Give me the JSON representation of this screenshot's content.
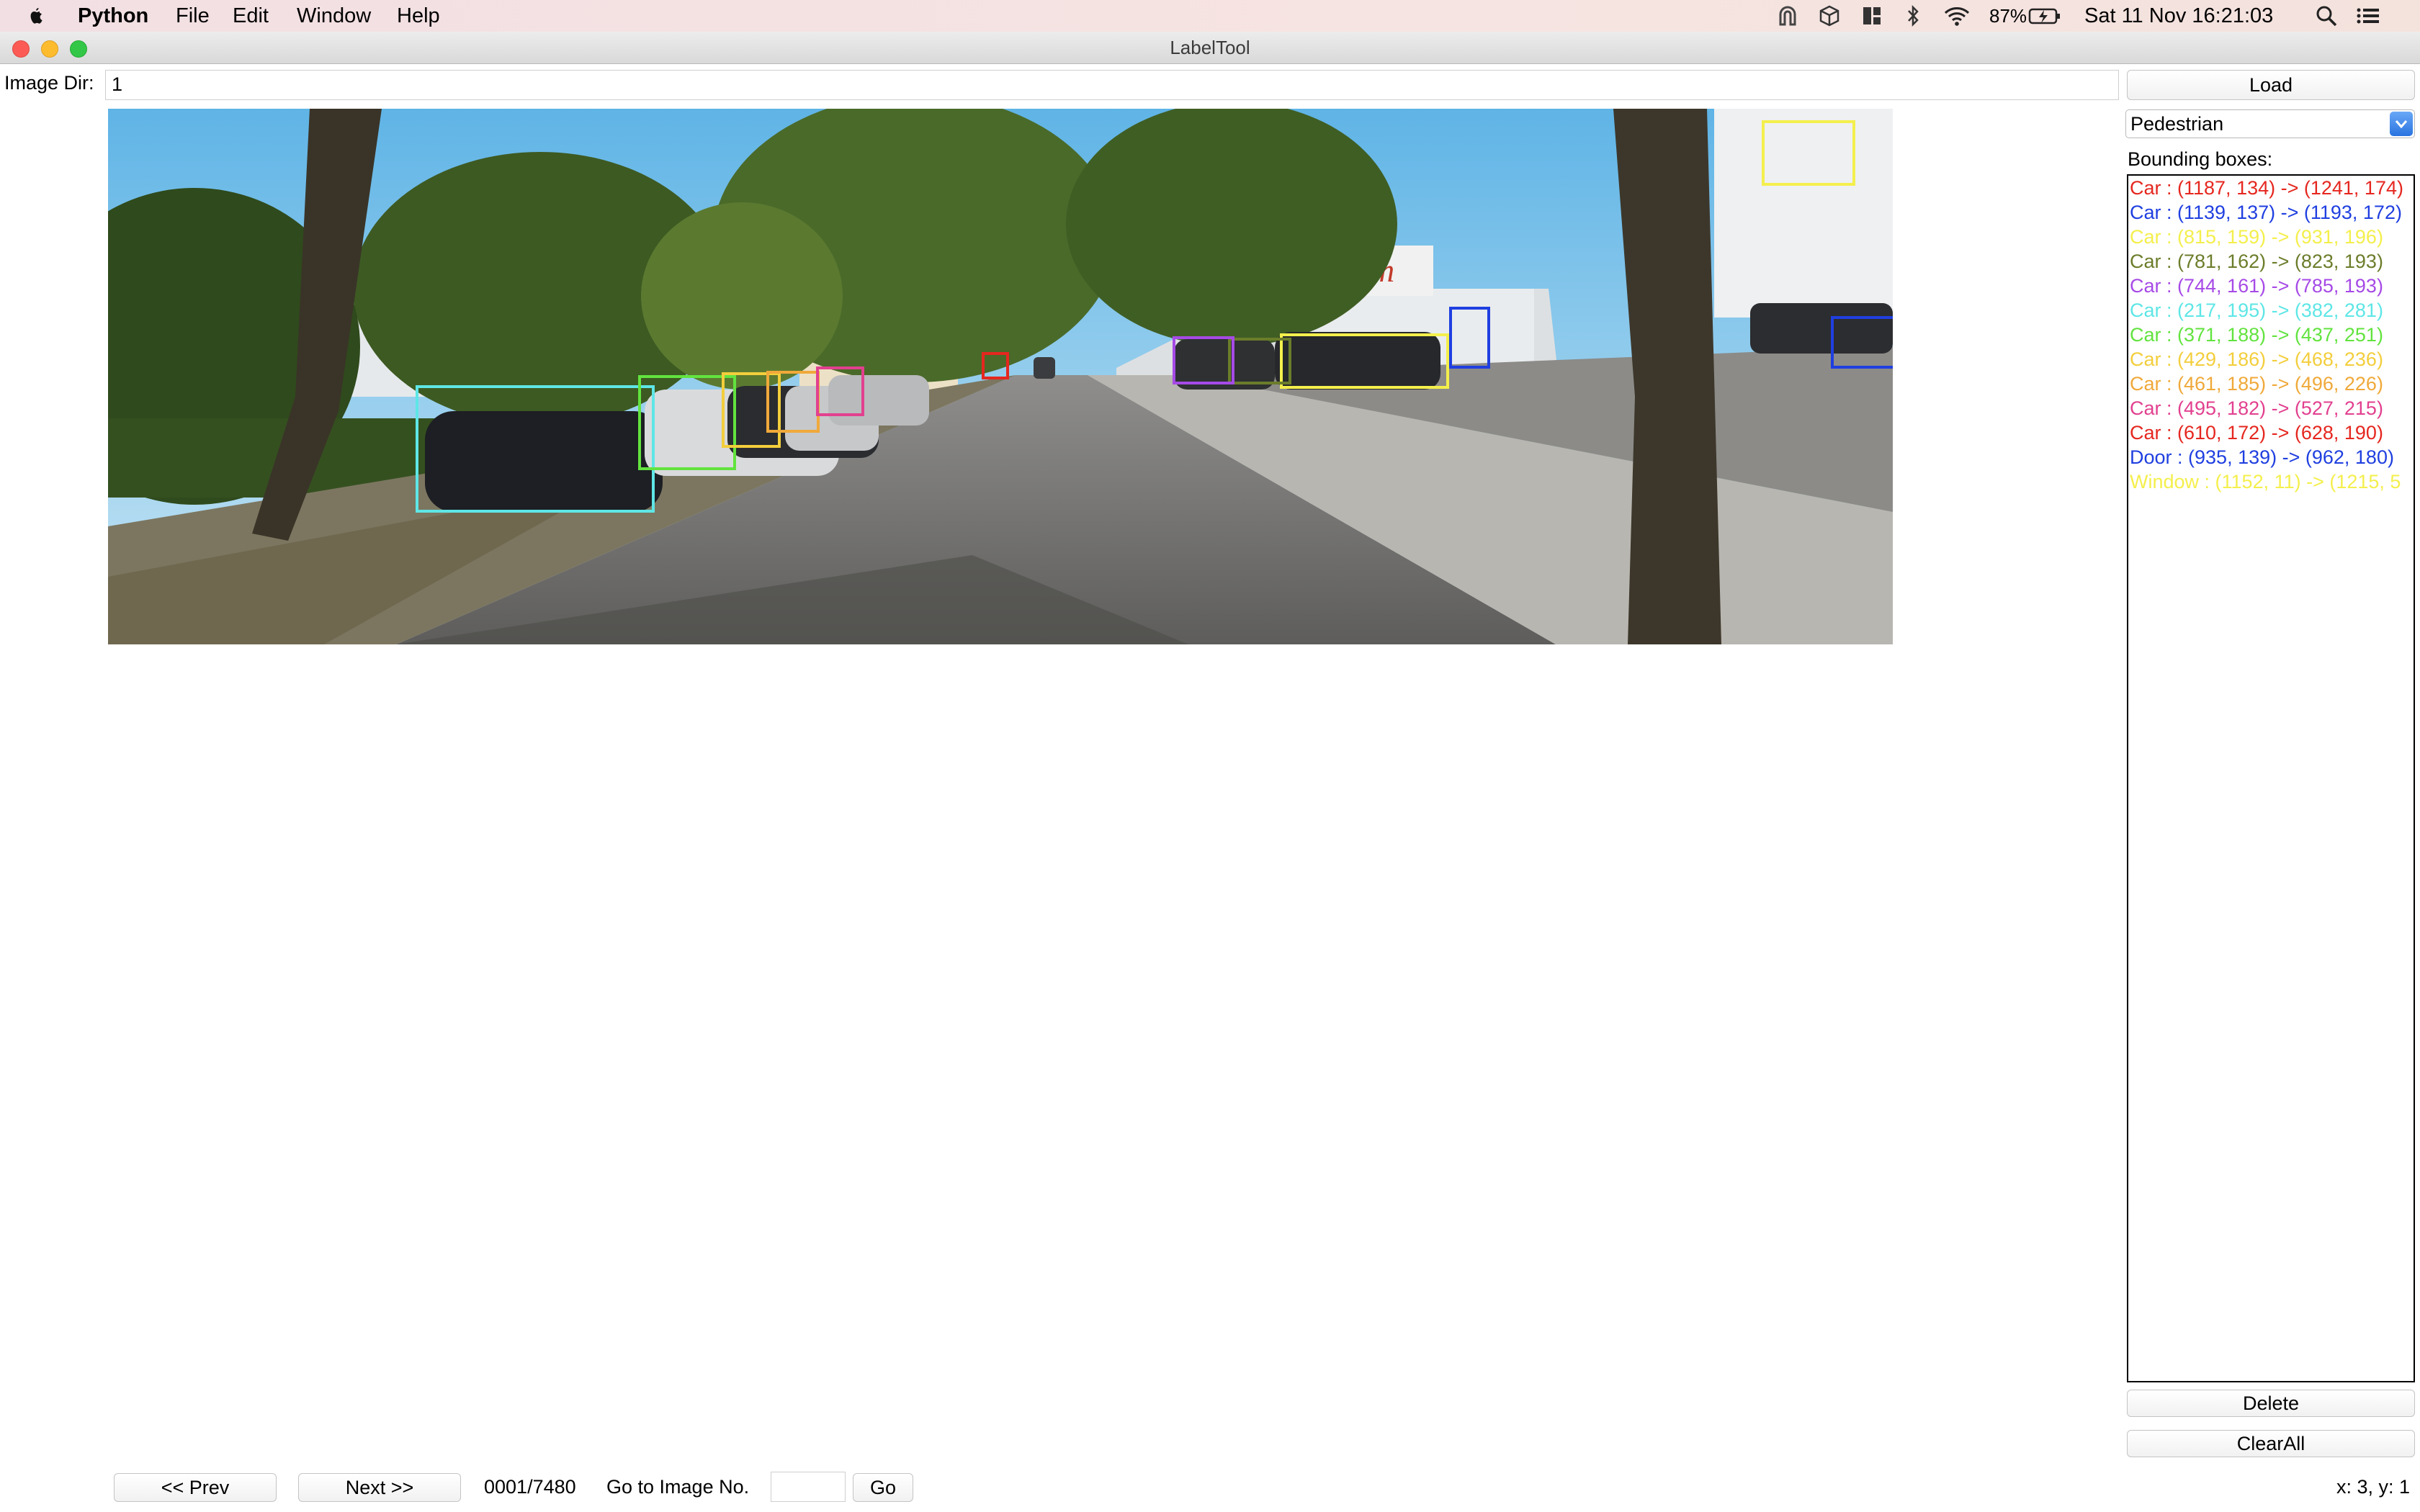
{
  "menubar": {
    "app_name": "Python",
    "menus": [
      "File",
      "Edit",
      "Window",
      "Help"
    ],
    "battery": "87%",
    "clock": "Sat 11 Nov  16:21:03"
  },
  "window": {
    "title": "LabelTool"
  },
  "image_dir": {
    "label": "Image Dir:",
    "value": "1"
  },
  "load_button": "Load",
  "class_select": {
    "selected": "Pedestrian"
  },
  "bbox_panel": {
    "heading": "Bounding boxes:",
    "items": [
      {
        "text": "Car : (1187, 134) -> (1241, 174)",
        "color": "#e5271f"
      },
      {
        "text": "Car : (1139, 137) -> (1193, 172)",
        "color": "#1f3fe0"
      },
      {
        "text": "Car : (815, 159) -> (931, 196)",
        "color": "#f4ef4c"
      },
      {
        "text": "Car : (781, 162) -> (823, 193)",
        "color": "#6b7d2a"
      },
      {
        "text": "Car : (744, 161) -> (785, 193)",
        "color": "#a64ae6"
      },
      {
        "text": "Car : (217, 195) -> (382, 281)",
        "color": "#5ee6e6"
      },
      {
        "text": "Car : (371, 188) -> (437, 251)",
        "color": "#62e33f"
      },
      {
        "text": "Car : (429, 186) -> (468, 236)",
        "color": "#f3ce3c"
      },
      {
        "text": "Car : (461, 185) -> (496, 226)",
        "color": "#f0a93a"
      },
      {
        "text": "Car : (495, 182) -> (527, 215)",
        "color": "#e2408f"
      },
      {
        "text": "Car : (610, 172) -> (628, 190)",
        "color": "#e5271f"
      },
      {
        "text": "Door : (935, 139) -> (962, 180)",
        "color": "#1f3fe0"
      },
      {
        "text": "Window : (1152, 11) -> (1215, 5",
        "color": "#f4ef4c"
      }
    ]
  },
  "delete_button": "Delete",
  "clearall_button": "ClearAll",
  "nav": {
    "prev": "<< Prev",
    "next": "Next >>",
    "progress": "0001/7480",
    "goto_label": "Go to Image No.",
    "goto_value": "",
    "go": "Go"
  },
  "coords": "x: 3, y: 1"
}
